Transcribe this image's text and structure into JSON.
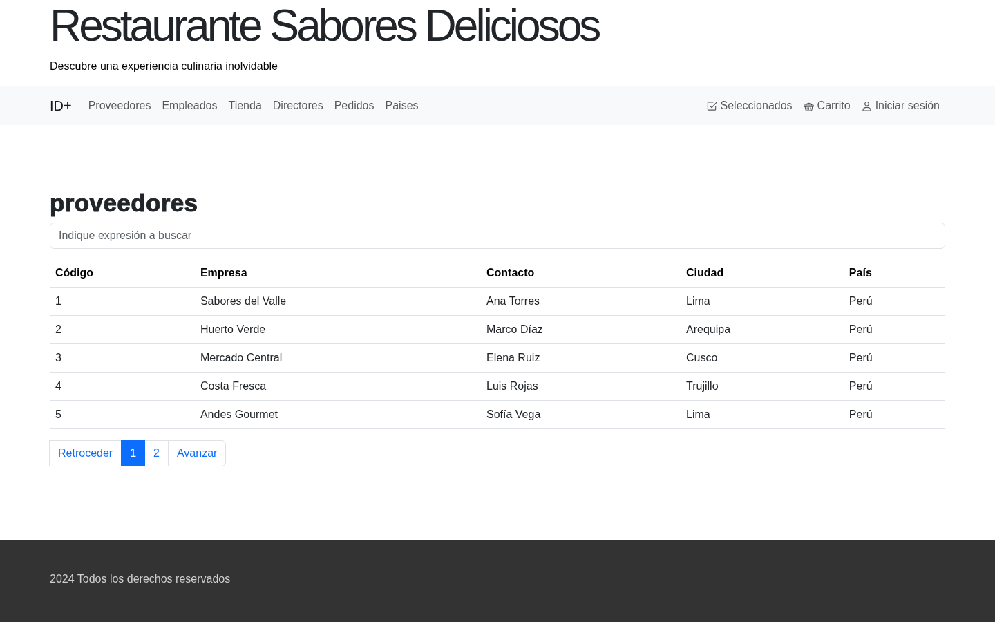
{
  "header": {
    "title": "Restaurante Sabores Deliciosos",
    "subtitle": "Descubre una experiencia culinaria inolvidable"
  },
  "navbar": {
    "brand": "ID+",
    "links": [
      "Proveedores",
      "Empleados",
      "Tienda",
      "Directores",
      "Pedidos",
      "Paises"
    ],
    "actions": [
      {
        "kind": "checklist",
        "label": "Seleccionados"
      },
      {
        "kind": "basket",
        "label": "Carrito"
      },
      {
        "kind": "user",
        "label": "Iniciar sesión"
      }
    ]
  },
  "content": {
    "heading": "proveedores",
    "search": {
      "placeholder": "Indique expresión a buscar"
    },
    "table": {
      "columns": [
        "Código",
        "Empresa",
        "Contacto",
        "Ciudad",
        "País"
      ],
      "rows": [
        [
          "1",
          "Sabores del Valle",
          "Ana Torres",
          "Lima",
          "Perú"
        ],
        [
          "2",
          "Huerto Verde",
          "Marco Díaz",
          "Arequipa",
          "Perú"
        ],
        [
          "3",
          "Mercado Central",
          "Elena Ruiz",
          "Cusco",
          "Perú"
        ],
        [
          "4",
          "Costa Fresca",
          "Luis Rojas",
          "Trujillo",
          "Perú"
        ],
        [
          "5",
          "Andes Gourmet",
          "Sofía Vega",
          "Lima",
          "Perú"
        ]
      ]
    },
    "pagination": [
      {
        "label": "Retroceder",
        "selected": false
      },
      {
        "label": "1",
        "selected": true
      },
      {
        "label": "2",
        "selected": false
      },
      {
        "label": "Avanzar",
        "selected": false
      }
    ]
  },
  "footer": {
    "text": "2024 Todos los derechos reservados"
  }
}
